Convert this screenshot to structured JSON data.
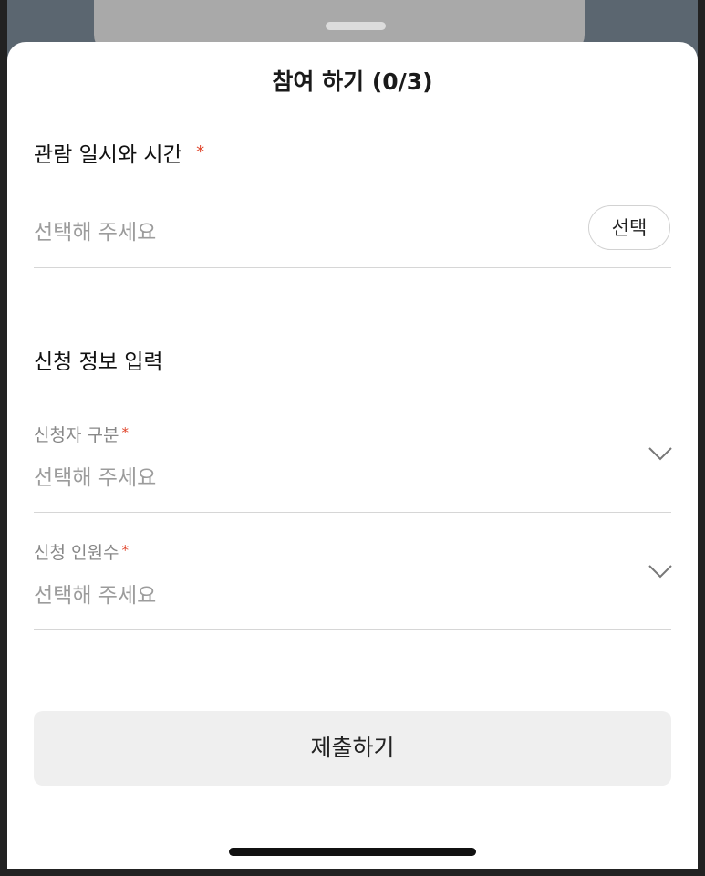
{
  "sheet": {
    "title": "참여 하기 (0/3)"
  },
  "viewing_datetime": {
    "label": "관람 일시와 시간",
    "required_mark": "*",
    "placeholder": "선택해 주세요",
    "select_button": "선택"
  },
  "applicant_info": {
    "section_title": "신청 정보 입력",
    "applicant_type": {
      "label": "신청자 구분",
      "required_mark": "*",
      "placeholder": "선택해 주세요",
      "icon": "chevron-down-icon"
    },
    "headcount": {
      "label": "신청 인원수",
      "required_mark": "*",
      "placeholder": "선택해 주세요",
      "icon": "chevron-down-icon"
    }
  },
  "submit": {
    "label": "제출하기"
  },
  "colors": {
    "required": "#e0452b",
    "submit_bg": "#efefef",
    "placeholder": "#9c9c9c"
  }
}
